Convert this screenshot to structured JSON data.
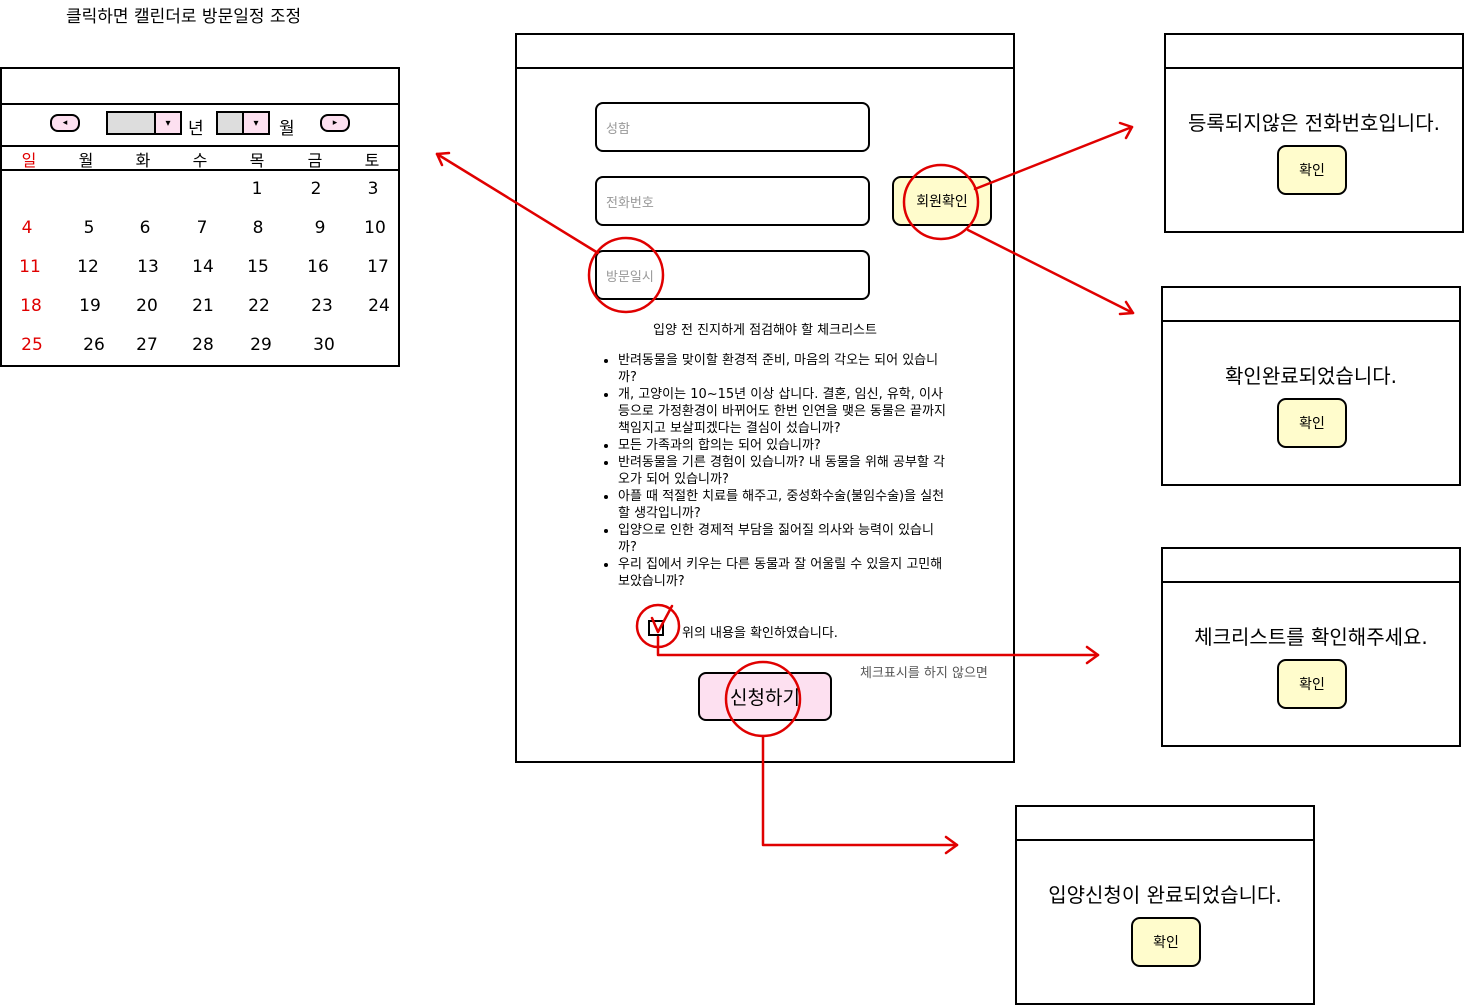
{
  "annotations": {
    "calendar_note": "클릭하면 캘린더로 방문일정 조정",
    "checkbox_note": "체크표시를 하지 않으면"
  },
  "calendar": {
    "prev_icon": "◂",
    "next_icon": "▸",
    "year_unit": "년",
    "month_unit": "월",
    "dropdown_icon": "▾",
    "weekdays": [
      "일",
      "월",
      "화",
      "수",
      "목",
      "금",
      "토"
    ],
    "weeks": [
      [
        "",
        "",
        "",
        "",
        "1",
        "2",
        "3"
      ],
      [
        "4",
        "5",
        "6",
        "7",
        "8",
        "9",
        "10"
      ],
      [
        "11",
        "12",
        "13",
        "14",
        "15",
        "16",
        "17"
      ],
      [
        "18",
        "19",
        "20",
        "21",
        "22",
        "23",
        "24"
      ],
      [
        "25",
        "26",
        "27",
        "28",
        "29",
        "30",
        ""
      ]
    ]
  },
  "form": {
    "name_placeholder": "성함",
    "phone_placeholder": "전화번호",
    "visit_placeholder": "방문일시",
    "member_check_label": "회원확인",
    "checklist_title": "입양 전 진지하게 점검해야 할 체크리스트",
    "checklist": [
      "반려동물을 맞이할 환경적 준비, 마음의 각오는 되어 있습니까?",
      "개, 고양이는 10~15년 이상 삽니다. 결혼, 임신, 유학, 이사 등으로 가정환경이 바뀌어도 한번 인연을 맺은 동물은 끝까지 책임지고 보살피겠다는 결심이 섰습니까?",
      "모든 가족과의 합의는 되어 있습니까?",
      "반려동물을 기른 경험이 있습니까? 내 동물을 위해 공부할 각오가 되어 있습니까?",
      "아플 때 적절한 치료를 해주고, 중성화수술(불임수술)을 실천할 생각입니까?",
      "입양으로 인한 경제적 부담을 짊어질 의사와 능력이 있습니까?",
      "우리 집에서 키우는 다른 동물과 잘 어울릴 수 있을지 고민해보았습니까?"
    ],
    "confirm_text": "위의 내용을 확인하였습니다.",
    "submit_label": "신청하기"
  },
  "dialogs": {
    "not_registered": {
      "message": "등록되지않은 전화번호입니다.",
      "ok": "확인"
    },
    "confirmed": {
      "message": "확인완료되었습니다.",
      "ok": "확인"
    },
    "check_required": {
      "message": "체크리스트를 확인해주세요.",
      "ok": "확인"
    },
    "completed": {
      "message": "입양신청이 완료되었습니다.",
      "ok": "확인"
    }
  },
  "colors": {
    "annotation_red": "#e00000",
    "button_yellow": "#fffccc",
    "button_pink": "#fde0f0",
    "sunday_red": "#e00000"
  }
}
